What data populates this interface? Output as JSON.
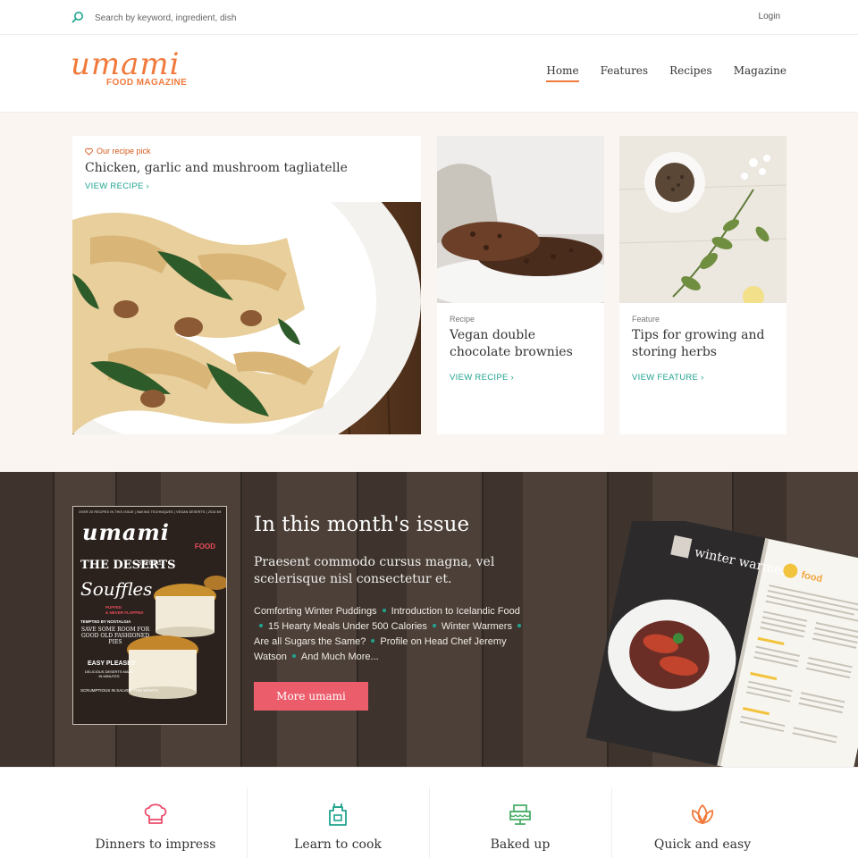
{
  "topbar": {
    "search_placeholder": "Search by keyword, ingredient, dish",
    "login_label": "Login"
  },
  "header": {
    "logo_word": "umami",
    "logo_sub": "FOOD MAGAZINE",
    "nav": [
      {
        "label": "Home",
        "active": true
      },
      {
        "label": "Features",
        "active": false
      },
      {
        "label": "Recipes",
        "active": false
      },
      {
        "label": "Magazine",
        "active": false
      }
    ]
  },
  "featured": {
    "main": {
      "kicker": "Our recipe pick",
      "title": "Chicken, garlic and mushroom tagliatelle",
      "link": "VIEW RECIPE"
    },
    "cards": [
      {
        "kicker": "Recipe",
        "title": "Vegan double chocolate brownies",
        "link": "VIEW RECIPE"
      },
      {
        "kicker": "Feature",
        "title": "Tips for growing and storing herbs",
        "link": "VIEW FEATURE"
      }
    ]
  },
  "issue": {
    "heading": "In this month's issue",
    "sub": "Praesent commodo cursus magna, vel scelerisque nisl consectetur et.",
    "topics": [
      "Comforting Winter Puddings",
      "Introduction to Icelandic Food",
      "15 Hearty Meals Under 500 Calories",
      "Winter Warmers",
      "Are all Sugars the Same?",
      "Profile on Head Chef Jeremy Watson",
      "And Much More..."
    ],
    "button_label": "More umami",
    "cover": {
      "top_lines": "OVER 20 RECIPES IN THIS ISSUE  |  BAKING TECHNIQUES  |  VEGAN DESERTS  |  2016 MENUS",
      "logo": "umami",
      "food": "FOOD",
      "deserts": "THE DESERTS",
      "special": "SPECIAL",
      "souffles": "Souffles",
      "puffed": "PUFFED\n& NEVER FLOPPED",
      "tempted": "TEMPTED BY NOSTALGIA",
      "save": "SAVE SOME ROOM FOR GOOD OLD FASHIONED PIES",
      "easy": "EASY PLEASEY",
      "delicious": "DELICIOUS DESERTS MADE IN MINUTES",
      "scrump": "SCRUMPTIOUS IN SALVER THIS MONTH"
    },
    "spread_title": "winter warmers",
    "spread_logo": "food"
  },
  "categories": [
    {
      "label": "Dinners to impress",
      "icon": "chef-hat-icon",
      "color": "#e94d6c"
    },
    {
      "label": "Learn to cook",
      "icon": "apron-icon",
      "color": "#20a38f"
    },
    {
      "label": "Baked up",
      "icon": "cake-icon",
      "color": "#4cae6a"
    },
    {
      "label": "Quick and easy",
      "icon": "lotus-icon",
      "color": "#f07a3c"
    }
  ],
  "colors": {
    "accent_orange": "#f07a3c",
    "accent_teal": "#20a38f",
    "button_pink": "#ec5d6c",
    "featured_bg": "#faf5f1"
  }
}
